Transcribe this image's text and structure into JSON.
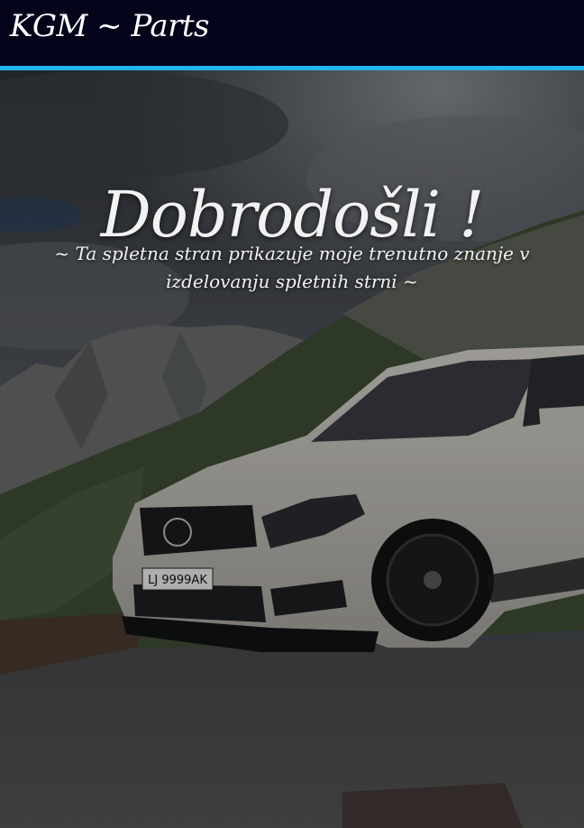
{
  "navbar": {
    "brand": "KGM ~ Parts",
    "accent_color": "#1fb6ea",
    "background_color": "#03031a"
  },
  "hero": {
    "title": "Dobrodošli !",
    "subtitle": "~ Ta spletna stran prikazuje moje trenutno znanje v izdelovanju spletnih strni ~",
    "background_image": {
      "license_plate": "LJ 9999AK"
    }
  }
}
